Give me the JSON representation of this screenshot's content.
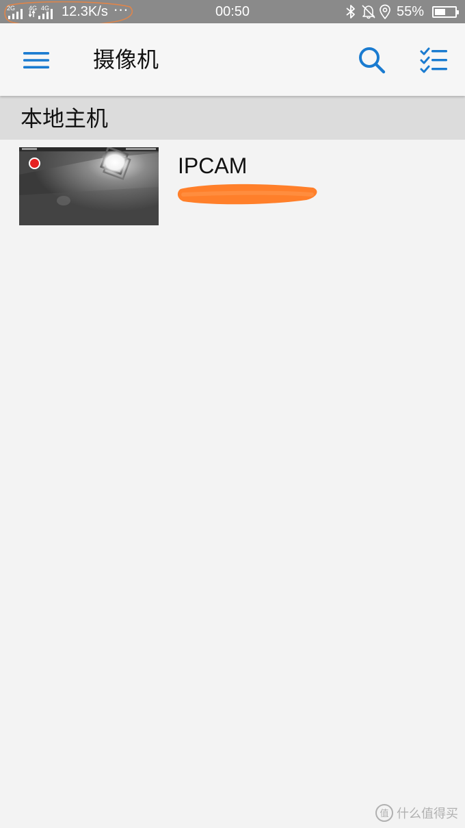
{
  "status_bar": {
    "network_2g": "2G",
    "network_4g_a": "4G",
    "network_4g_b": "4G",
    "speed": "12.3K/s",
    "more": "···",
    "time": "00:50",
    "battery_percent": "55%",
    "battery_level": 0.55,
    "icons": [
      "signal-icon",
      "signal-icon",
      "bluetooth-icon",
      "bell-off-icon",
      "location-icon",
      "battery-icon"
    ]
  },
  "app_bar": {
    "title": "摄像机",
    "icons": [
      "menu-icon",
      "search-icon",
      "checklist-icon"
    ],
    "accent_color": "#1a7bd0"
  },
  "section": {
    "title": "本地主机"
  },
  "cameras": [
    {
      "name": "IPCAM",
      "recording": true
    }
  ],
  "watermark": {
    "text": "什么值得买"
  }
}
